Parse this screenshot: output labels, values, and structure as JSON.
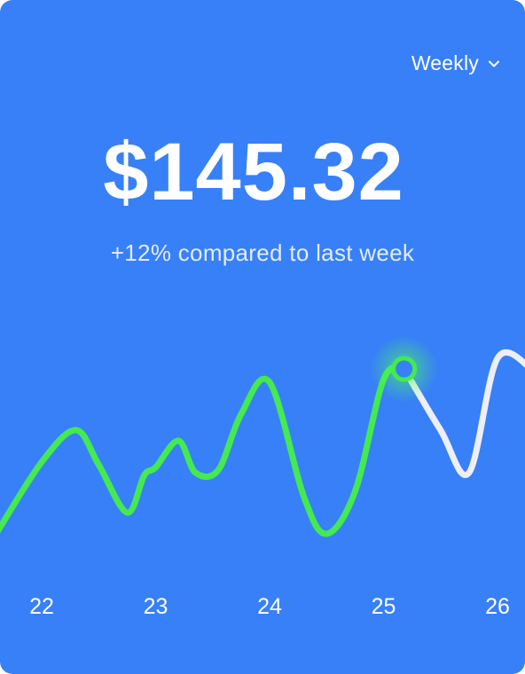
{
  "header": {
    "period": "Weekly",
    "chevron_icon": "chevron-down-icon"
  },
  "summary": {
    "amount": "$145.32",
    "comparison": "+12% compared to last week"
  },
  "colors": {
    "background": "#3780f8",
    "line_past": "#44ea4f",
    "line_future": "#eeeef6",
    "marker_glow": "#4cff52",
    "text": "#ffffff"
  },
  "chart_data": {
    "type": "line",
    "categories": [
      "22",
      "23",
      "24",
      "25",
      "26"
    ],
    "series": [
      {
        "x": [
          21.6,
          22.0,
          22.3,
          22.5,
          22.75,
          22.9,
          23.0,
          23.2,
          23.35,
          23.55,
          23.75,
          24.0,
          24.3,
          24.5,
          24.75,
          25.0,
          25.18,
          25.5,
          25.75,
          26.0,
          26.3
        ],
        "values": [
          52,
          79,
          91,
          78,
          60,
          74,
          77,
          87,
          75,
          76,
          97,
          109,
          66,
          52,
          68,
          110,
          114,
          91,
          75,
          118,
          114
        ]
      }
    ],
    "highlight": {
      "x": 25.18,
      "value": 114
    },
    "current_index": 16,
    "ylim": [
      0,
      240
    ],
    "xlim": [
      21.6,
      26.3
    ]
  }
}
